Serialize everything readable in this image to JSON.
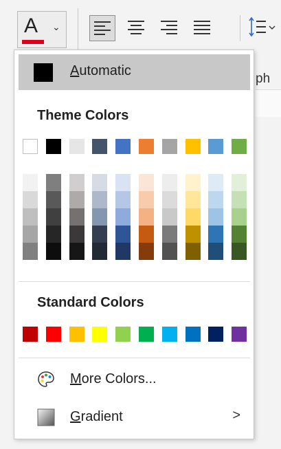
{
  "ribbon": {
    "font_color_letter": "A",
    "font_color_bar": "#e0001b",
    "paragraph_label_fragment": "ph"
  },
  "menu": {
    "automatic": {
      "mnemonic": "A",
      "rest": "utomatic",
      "swatch": "#000000"
    },
    "theme_header": "Theme Colors",
    "theme_top": [
      "#ffffff",
      "#000000",
      "#e7e6e6",
      "#44546a",
      "#4472c4",
      "#ed7d31",
      "#a5a5a5",
      "#ffc000",
      "#5b9bd5",
      "#70ad47"
    ],
    "theme_shades": [
      [
        "#f2f2f2",
        "#d9d9d9",
        "#bfbfbf",
        "#a6a6a6",
        "#808080"
      ],
      [
        "#7f7f7f",
        "#595959",
        "#404040",
        "#262626",
        "#0d0d0d"
      ],
      [
        "#d0cece",
        "#aeaaaa",
        "#767171",
        "#3a3838",
        "#171616"
      ],
      [
        "#d6dce5",
        "#adb9ca",
        "#8497b0",
        "#333f50",
        "#222a35"
      ],
      [
        "#dae3f3",
        "#b4c7e7",
        "#8faadc",
        "#2f5597",
        "#1f3864"
      ],
      [
        "#fbe5d6",
        "#f8cbad",
        "#f4b183",
        "#c55a11",
        "#843c0c"
      ],
      [
        "#ededed",
        "#dbdbdb",
        "#c9c9c9",
        "#7b7b7b",
        "#525252"
      ],
      [
        "#fff2cc",
        "#ffe699",
        "#ffd966",
        "#bf9000",
        "#7f6000"
      ],
      [
        "#deebf7",
        "#bdd7ee",
        "#9dc3e6",
        "#2e75b6",
        "#1f4e79"
      ],
      [
        "#e2f0d9",
        "#c5e0b4",
        "#a9d18e",
        "#548235",
        "#385723"
      ]
    ],
    "standard_header": "Standard Colors",
    "standard": [
      "#c00000",
      "#ff0000",
      "#ffc000",
      "#ffff00",
      "#92d050",
      "#00b050",
      "#00b0f0",
      "#0070c0",
      "#002060",
      "#7030a0"
    ],
    "more_colors": {
      "mnemonic": "M",
      "rest": "ore Colors...",
      "icon": "palette-icon"
    },
    "gradient": {
      "mnemonic": "G",
      "rest": "radient",
      "icon": "gradient-icon",
      "chevron": ">"
    }
  }
}
